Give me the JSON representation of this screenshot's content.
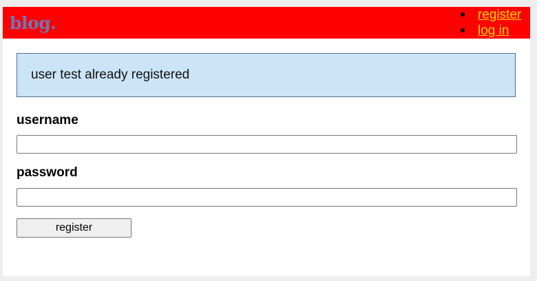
{
  "header": {
    "brand": "blog.",
    "nav": [
      {
        "label": "register"
      },
      {
        "label": "log in"
      }
    ]
  },
  "flash": {
    "message": "user test already registered"
  },
  "form": {
    "username_label": "username",
    "username_value": "",
    "password_label": "password",
    "password_value": "",
    "submit_label": "register"
  },
  "colors": {
    "navbar": "#ff0000",
    "brand": "#6b77b8",
    "nav_link": "#ffd60a",
    "flash_bg": "#cce4f7",
    "flash_border": "#4f6f8f"
  }
}
